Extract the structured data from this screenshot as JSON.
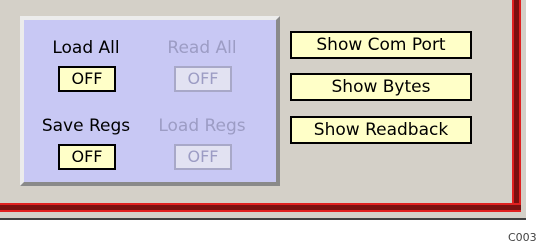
{
  "panel": {
    "load_all": {
      "label": "Load All",
      "button": "OFF",
      "enabled": true
    },
    "read_all": {
      "label": "Read All",
      "button": "OFF",
      "enabled": false
    },
    "save_regs": {
      "label": "Save Regs",
      "button": "OFF",
      "enabled": true
    },
    "load_regs": {
      "label": "Load Regs",
      "button": "OFF",
      "enabled": false
    }
  },
  "buttons": {
    "show_com_port": "Show Com Port",
    "show_bytes": "Show Bytes",
    "show_readback": "Show Readback"
  },
  "footnote": "C003",
  "colors": {
    "window_bg": "#d4d0c8",
    "panel_bg": "#c8c8f4",
    "button_bg": "#ffffc8",
    "disabled_text": "#9c9cc4",
    "frame_red": "#e02020",
    "frame_dark": "#7a1010"
  }
}
